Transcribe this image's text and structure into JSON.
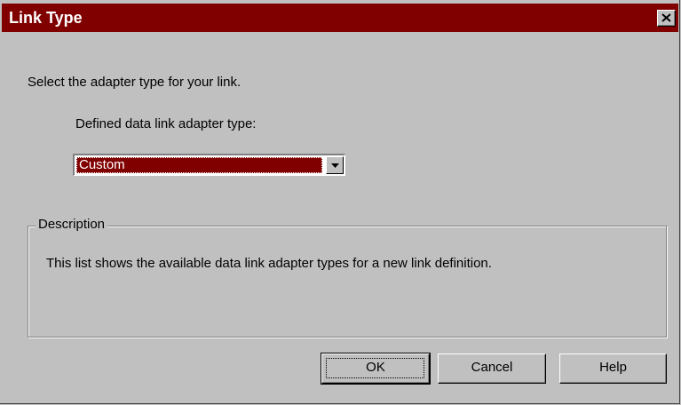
{
  "window": {
    "title": "Link Type",
    "close_icon": "close-icon"
  },
  "main": {
    "prompt": "Select the adapter type for your link.",
    "adapter_label": "Defined data link adapter type:",
    "adapter_select": {
      "selected": "Custom",
      "arrow_icon": "chevron-down-icon"
    }
  },
  "description": {
    "legend": "Description",
    "text": "This list shows the available data link adapter types for a new link definition."
  },
  "buttons": {
    "ok": "OK",
    "cancel": "Cancel",
    "help": "Help"
  },
  "colors": {
    "title_bar": "#800000",
    "selection": "#800000",
    "face": "#c0c0c0"
  }
}
